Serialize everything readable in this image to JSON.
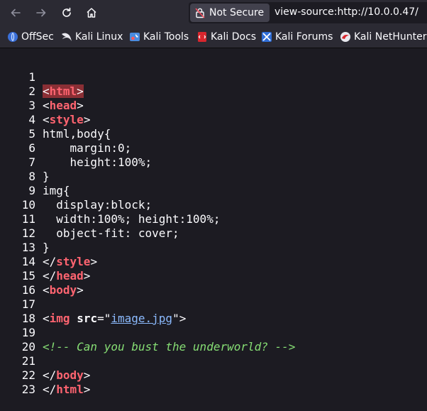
{
  "browser": {
    "security_label": "Not Secure",
    "url": "view-source:http://10.0.0.47/"
  },
  "bookmarks": [
    {
      "label": "OffSec",
      "icon": "offsec-icon"
    },
    {
      "label": "Kali Linux",
      "icon": "kali-dragon-icon"
    },
    {
      "label": "Kali Tools",
      "icon": "kali-tools-icon"
    },
    {
      "label": "Kali Docs",
      "icon": "kali-docs-icon"
    },
    {
      "label": "Kali Forums",
      "icon": "kali-forums-icon"
    },
    {
      "label": "Kali NetHunter",
      "icon": "kali-nethunter-icon"
    }
  ],
  "source": {
    "line_numbers": [
      "1",
      "2",
      "3",
      "4",
      "5",
      "6",
      "7",
      "8",
      "9",
      "10",
      "11",
      "12",
      "13",
      "14",
      "15",
      "16",
      "17",
      "18",
      "19",
      "20",
      "21",
      "22",
      "23"
    ],
    "css": {
      "l4": "html,body{",
      "l5": "    margin:0;",
      "l6": "    height:100%;",
      "l7": "}",
      "l8": "img{",
      "l9": "  display:block;",
      "l10": "  width:100%; height:100%;",
      "l11": "  object-fit: cover;",
      "l12": "}"
    },
    "tags": {
      "html": "html",
      "head": "head",
      "style": "style",
      "body": "body",
      "img": "img"
    },
    "img_attr": "src",
    "img_src": "image.jpg",
    "comment": "<!-- Can you bust the underworld? -->"
  }
}
